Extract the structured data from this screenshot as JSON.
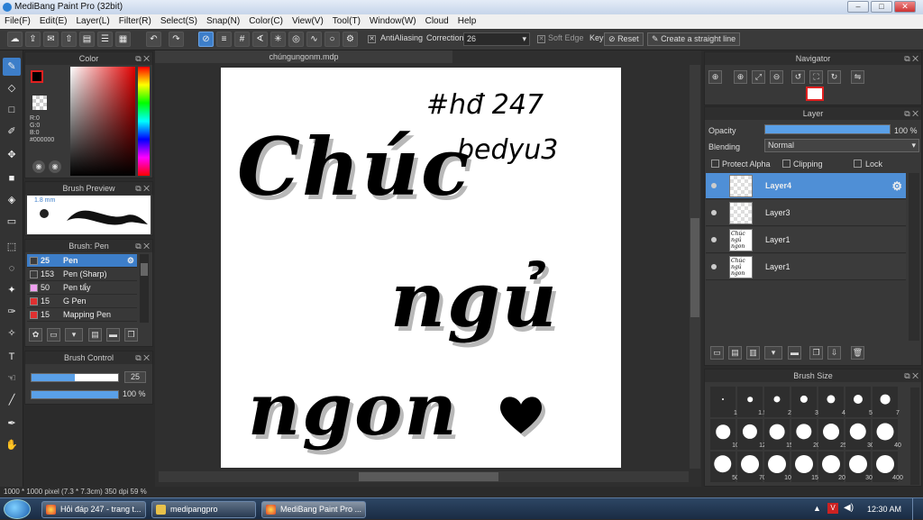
{
  "window": {
    "title": "MediBang Paint Pro (32bit)"
  },
  "menu": [
    "File(F)",
    "Edit(E)",
    "Layer(L)",
    "Filter(R)",
    "Select(S)",
    "Snap(N)",
    "Color(C)",
    "View(V)",
    "Tool(T)",
    "Window(W)",
    "Cloud",
    "Help"
  ],
  "toolbar": {
    "antialiasing_label": "AntiAliasing",
    "correction_label": "Correction",
    "correction_value": "26",
    "soft_edge_label": "Soft Edge",
    "key_label": "Key",
    "reset_label": "Reset",
    "straight_line_label": "Create a straight line"
  },
  "color_panel": {
    "title": "Color",
    "r": "R:0",
    "g": "G:0",
    "b": "B:0",
    "hex": "#000000"
  },
  "brush_preview": {
    "title": "Brush Preview",
    "size": "1.8 mm"
  },
  "brush_panel": {
    "title": "Brush: Pen",
    "items": [
      {
        "size": "25",
        "name": "Pen",
        "color": "#3c3c3c"
      },
      {
        "size": "153",
        "name": "Pen (Sharp)",
        "color": "#3c3c3c"
      },
      {
        "size": "50",
        "name": "Pen tẩy",
        "color": "#f0a0f0"
      },
      {
        "size": "15",
        "name": "G Pen",
        "color": "#e03030"
      },
      {
        "size": "15",
        "name": "Mapping Pen",
        "color": "#e03030"
      }
    ]
  },
  "brush_control": {
    "title": "Brush Control",
    "size_value": "25",
    "opacity_value": "100 %"
  },
  "canvas": {
    "tab_title": "chúngungonm.mdp",
    "artwork_lines": [
      "Chúc",
      "ngủ",
      "ngon"
    ],
    "hashtag": "#hđ 247",
    "signature": "bedyu3"
  },
  "navigator": {
    "title": "Navigator"
  },
  "layer_panel": {
    "title": "Layer",
    "opacity_label": "Opacity",
    "opacity_value": "100 %",
    "blending_label": "Blending",
    "blending_value": "Normal",
    "protect_alpha": "Protect Alpha",
    "clipping": "Clipping",
    "lock": "Lock",
    "layers": [
      {
        "name": "Layer4",
        "thumb": ""
      },
      {
        "name": "Layer3",
        "thumb": ""
      },
      {
        "name": "Layer1",
        "thumb": "Chúc ngủ ngon"
      },
      {
        "name": "Layer1",
        "thumb": "Chúc ngủ ngon"
      }
    ]
  },
  "brush_size_panel": {
    "title": "Brush Size",
    "sizes": [
      "1",
      "1.5",
      "2",
      "3",
      "4",
      "5",
      "7",
      "10",
      "12",
      "15",
      "20",
      "25",
      "30",
      "40",
      "50",
      "70",
      "100",
      "150",
      "200",
      "300",
      "400"
    ]
  },
  "status": {
    "text": "1000 * 1000 pixel   (7.3 * 7.3cm)   350 dpi   59 %"
  },
  "taskbar": {
    "items": [
      "Hỏi đáp 247 - trang t...",
      "medipangpro",
      "MediBang Paint Pro ..."
    ],
    "clock": "12:30 AM"
  },
  "colors": {
    "accent": "#3d7ec9",
    "selected_layer": "#4f8fd6"
  }
}
